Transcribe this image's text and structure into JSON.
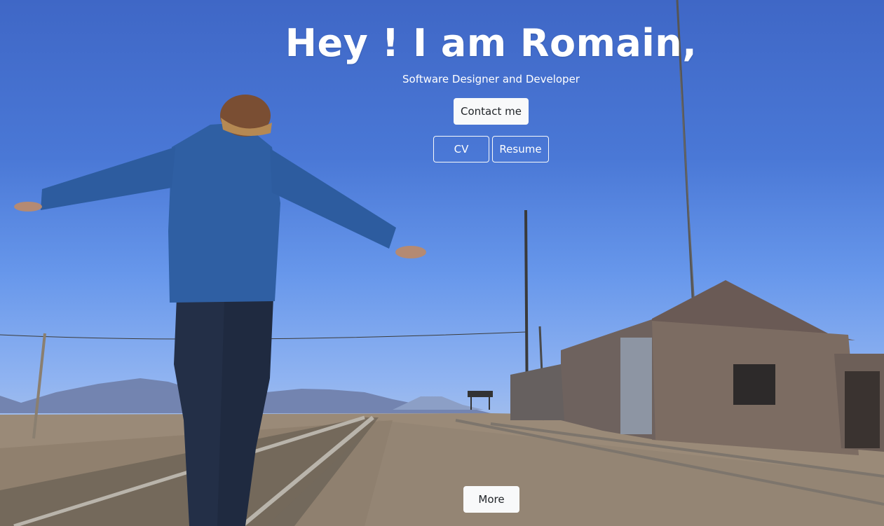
{
  "hero": {
    "title": "Hey ! I am Romain,",
    "subtitle": "Software Designer and Developer"
  },
  "buttons": {
    "contact": "Contact me",
    "cv": "CV",
    "resume": "Resume",
    "more": "More"
  },
  "colors": {
    "sky_top": "#3f67c6",
    "sky_bottom": "#8fb3f1",
    "button_light": "#f8f9fa",
    "text_dark": "#212529"
  }
}
